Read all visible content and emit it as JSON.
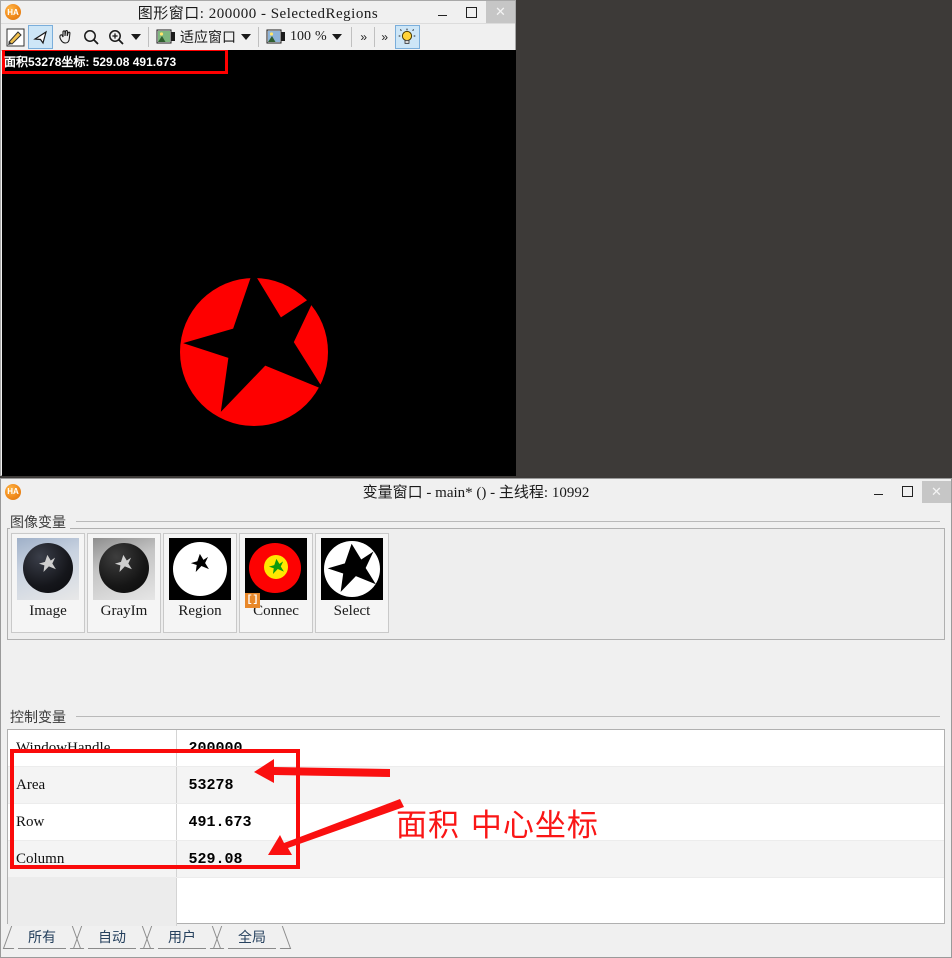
{
  "graphics_window": {
    "logo": "ha-logo",
    "title": "图形窗口: 200000 - SelectedRegions",
    "window_buttons": {
      "minimize": "–",
      "maximize": "□",
      "close": "✕"
    },
    "toolbar": {
      "edit_region_label": "edit-region-icon",
      "pointer_label": "pointer-icon",
      "pan_label": "hand-pan-icon",
      "zoom_label": "magnifier-icon",
      "zoom_in_label": "magnifier-plus-icon",
      "fit_window_label": "适应窗口",
      "zoom_value": "100",
      "percent_sign": "%",
      "overflow_1": "»",
      "overflow_2": "»",
      "lamp_label": "lightbulb-icon"
    },
    "status_overlay": "面积53278坐标: 529.08 491.673",
    "canvas": {
      "background_color": "#000000",
      "circle_color": "#fe0000",
      "star_color": "#000000"
    }
  },
  "variable_window": {
    "logo": "ha-logo",
    "title": "变量窗口 - main* () - 主线程: 10992",
    "window_buttons": {
      "minimize": "–",
      "maximize": "□",
      "close": "✕"
    },
    "image_vars_group_label": "图像变量",
    "image_vars": [
      {
        "label": "Image",
        "kind": "photo"
      },
      {
        "label": "GrayIm",
        "kind": "gray"
      },
      {
        "label": "Region",
        "kind": "region"
      },
      {
        "label": "Connec",
        "kind": "connected",
        "badge": "[]"
      },
      {
        "label": "Select",
        "kind": "select"
      }
    ],
    "control_vars_group_label": "控制变量",
    "control_vars": {
      "rows": [
        {
          "name": "WindowHandle",
          "value": "200000"
        },
        {
          "name": "Area",
          "value": "53278"
        },
        {
          "name": "Row",
          "value": "491.673"
        },
        {
          "name": "Column",
          "value": "529.08"
        }
      ]
    },
    "tabs": [
      {
        "label": "所有",
        "active": true
      },
      {
        "label": "自动",
        "active": false
      },
      {
        "label": "用户",
        "active": false
      },
      {
        "label": "全局",
        "active": false
      }
    ]
  },
  "annotations": {
    "highlight_color": "#fa0a0a",
    "callout_text": "面积 中心坐标",
    "status_box_name": "status-highlight-box",
    "table_box_name": "table-highlight-box"
  }
}
